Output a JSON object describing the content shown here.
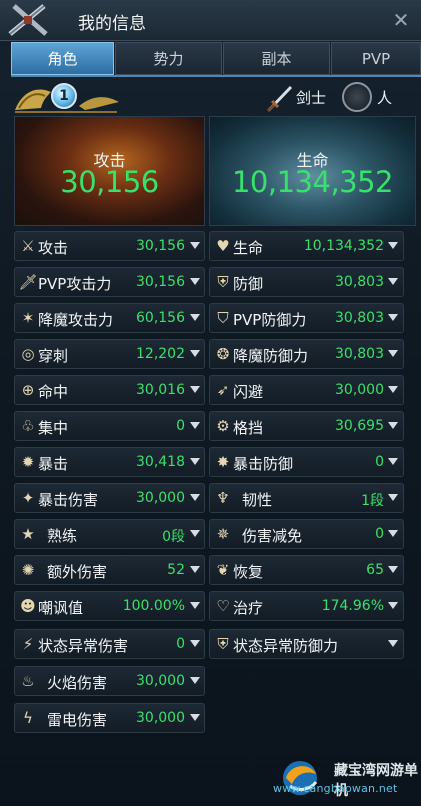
{
  "window": {
    "title": "我的信息",
    "close_icon": "close-icon"
  },
  "tabs": [
    {
      "label": "角色",
      "active": true
    },
    {
      "label": "势力",
      "active": false
    },
    {
      "label": "副本",
      "active": false
    },
    {
      "label": "PVP",
      "active": false
    }
  ],
  "header": {
    "level": "1",
    "class_label": "剑士",
    "race_label": "人"
  },
  "hero": {
    "attack": {
      "title": "攻击",
      "value": "30,156"
    },
    "life": {
      "title": "生命",
      "value": "10,134,352"
    }
  },
  "left_stats": [
    {
      "label": "攻击",
      "value": "30,156",
      "icon": "crossed-swords-icon"
    },
    {
      "label": "PVP攻击力",
      "value": "30,156",
      "icon": "pvp-attack-icon"
    },
    {
      "label": "降魔攻击力",
      "value": "60,156",
      "icon": "demon-attack-icon"
    },
    {
      "label": "穿刺",
      "value": "12,202",
      "icon": "pierce-icon"
    },
    {
      "label": "命中",
      "value": "30,016",
      "icon": "target-icon"
    },
    {
      "label": "集中",
      "value": "0",
      "icon": "focus-icon"
    },
    {
      "label": "暴击",
      "value": "30,418",
      "icon": "critical-icon"
    },
    {
      "label": "暴击伤害",
      "value": "30,000",
      "icon": "critical-damage-icon"
    },
    {
      "label": "熟练",
      "value": "0段",
      "icon": "mastery-icon"
    },
    {
      "label": "额外伤害",
      "value": "52",
      "icon": "extra-damage-icon"
    },
    {
      "label": "嘲讽值",
      "value": "100.00%",
      "icon": "taunt-icon"
    },
    {
      "label": "状态异常伤害",
      "value": "0",
      "icon": "status-damage-icon"
    },
    {
      "label": "火焰伤害",
      "value": "30,000",
      "icon": "fire-icon"
    },
    {
      "label": "雷电伤害",
      "value": "30,000",
      "icon": "lightning-icon"
    }
  ],
  "right_stats": [
    {
      "label": "生命",
      "value": "10,134,352",
      "icon": "heart-icon"
    },
    {
      "label": "防御",
      "value": "30,803",
      "icon": "shield-icon"
    },
    {
      "label": "PVP防御力",
      "value": "30,803",
      "icon": "pvp-shield-icon"
    },
    {
      "label": "降魔防御力",
      "value": "30,803",
      "icon": "demon-defense-icon"
    },
    {
      "label": "闪避",
      "value": "30,000",
      "icon": "evade-icon"
    },
    {
      "label": "格挡",
      "value": "30,695",
      "icon": "block-icon"
    },
    {
      "label": "暴击防御",
      "value": "0",
      "icon": "critical-defense-icon"
    },
    {
      "label": "韧性",
      "value": "1段",
      "icon": "toughness-icon"
    },
    {
      "label": "伤害减免",
      "value": "0",
      "icon": "damage-reduction-icon"
    },
    {
      "label": "恢复",
      "value": "65",
      "icon": "recovery-icon"
    },
    {
      "label": "治疗",
      "value": "174.96%",
      "icon": "heal-icon"
    },
    {
      "label": "状态异常防御力",
      "value": "",
      "icon": "status-defense-icon"
    }
  ],
  "watermark": {
    "line1": "藏宝湾网游单机",
    "line2": "www.cangbaowan.net"
  }
}
